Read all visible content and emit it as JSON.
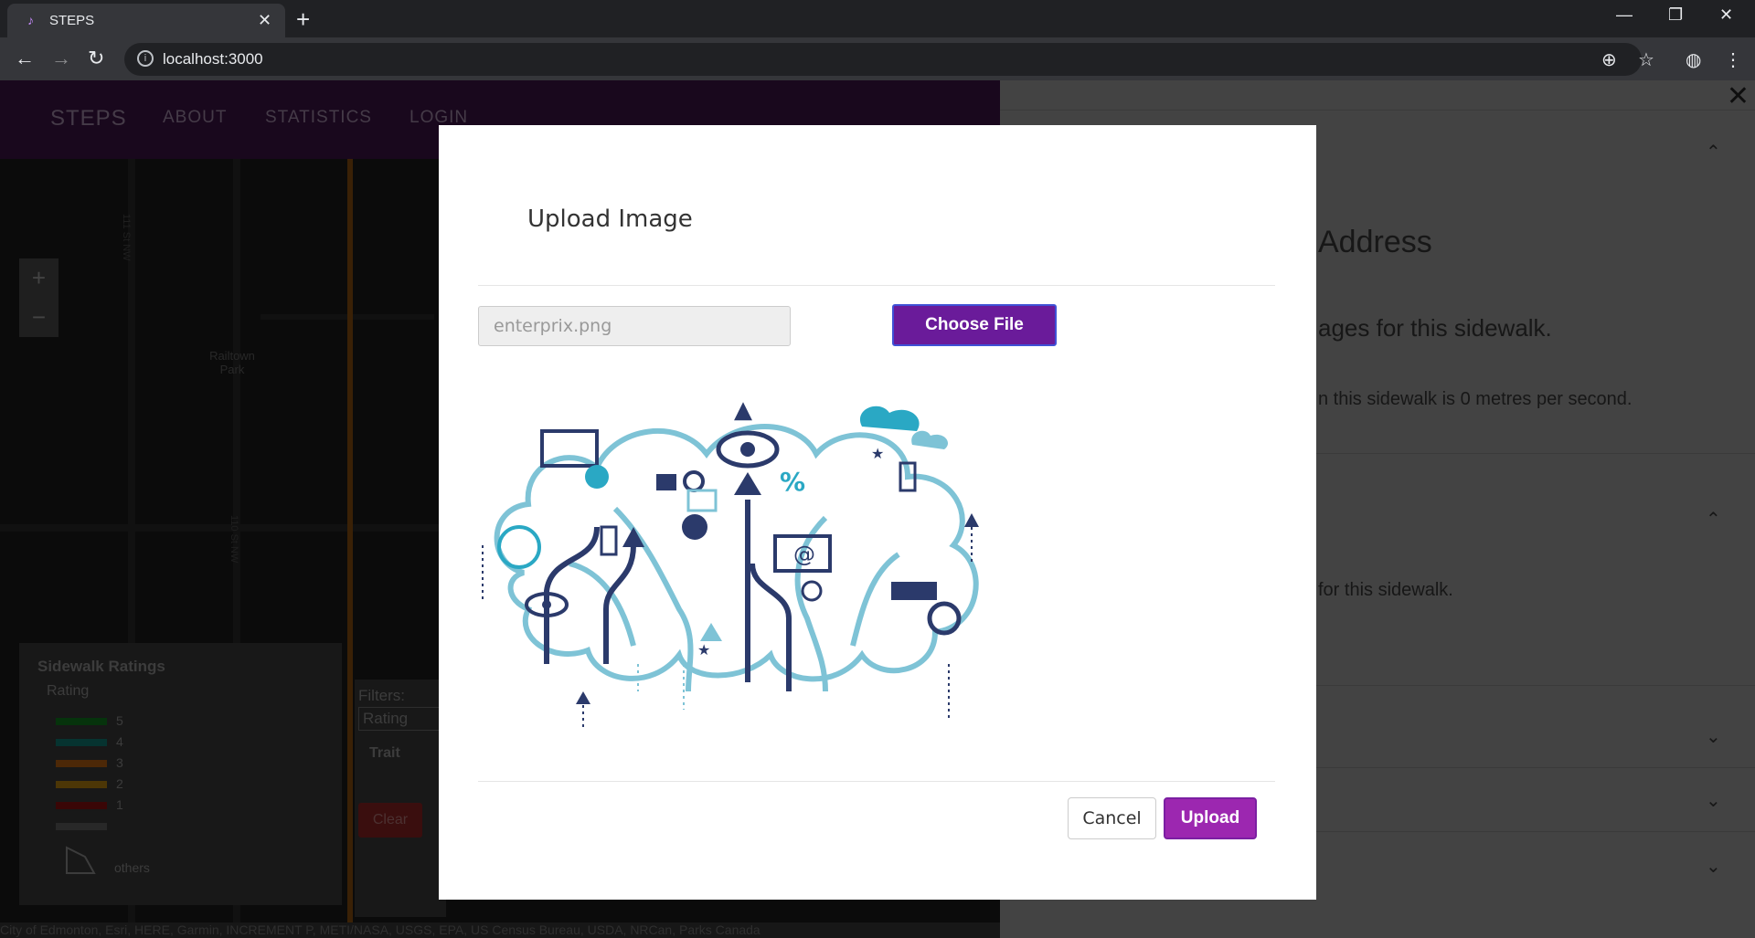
{
  "browser": {
    "tab_title": "STEPS",
    "url": "localhost:3000",
    "new_tab_label": "+",
    "tab_close": "✕"
  },
  "app": {
    "nav": {
      "brand": "STEPS",
      "items": [
        "ABOUT",
        "STATISTICS",
        "LOGIN"
      ]
    },
    "map": {
      "zoom_in": "+",
      "zoom_out": "−",
      "place_label": "Railtown Park",
      "street_labels": [
        "111 St NW",
        "110 St NW"
      ],
      "attribution": "City of Edmonton, Esri, HERE, Garmin, INCREMENT P, METI/NASA, USGS, EPA, US Census Bureau, USDA, NRCan, Parks Canada"
    },
    "legend": {
      "title": "Sidewalk Ratings",
      "subtitle": "Rating",
      "rows": [
        {
          "label": "5",
          "color": "#0b5e16"
        },
        {
          "label": "4",
          "color": "#0b5e58"
        },
        {
          "label": "3",
          "color": "#8a4a0e"
        },
        {
          "label": "2",
          "color": "#8a630b"
        },
        {
          "label": "1",
          "color": "#6b0b0b"
        },
        {
          "label": "",
          "color": "#4a4a4a"
        }
      ],
      "others_label": "others"
    },
    "filters": {
      "title": "Filters:",
      "rating_select": "Rating",
      "trait_label": "Trait",
      "clear_button": "Clear"
    },
    "side_panel": {
      "heading_fragment": "Address",
      "line1_fragment": "ages for this sidewalk.",
      "line2_fragment": "n this sidewalk is 0 metres per second.",
      "line3_fragment": "for this sidewalk."
    }
  },
  "modal": {
    "title": "Upload Image",
    "file_name": "enterprix.png",
    "choose_file_button": "Choose File",
    "cancel_button": "Cancel",
    "upload_button": "Upload",
    "preview_colors": {
      "light": "#7ec3d6",
      "dark": "#2b3a6b",
      "teal": "#2aa8c4"
    }
  }
}
